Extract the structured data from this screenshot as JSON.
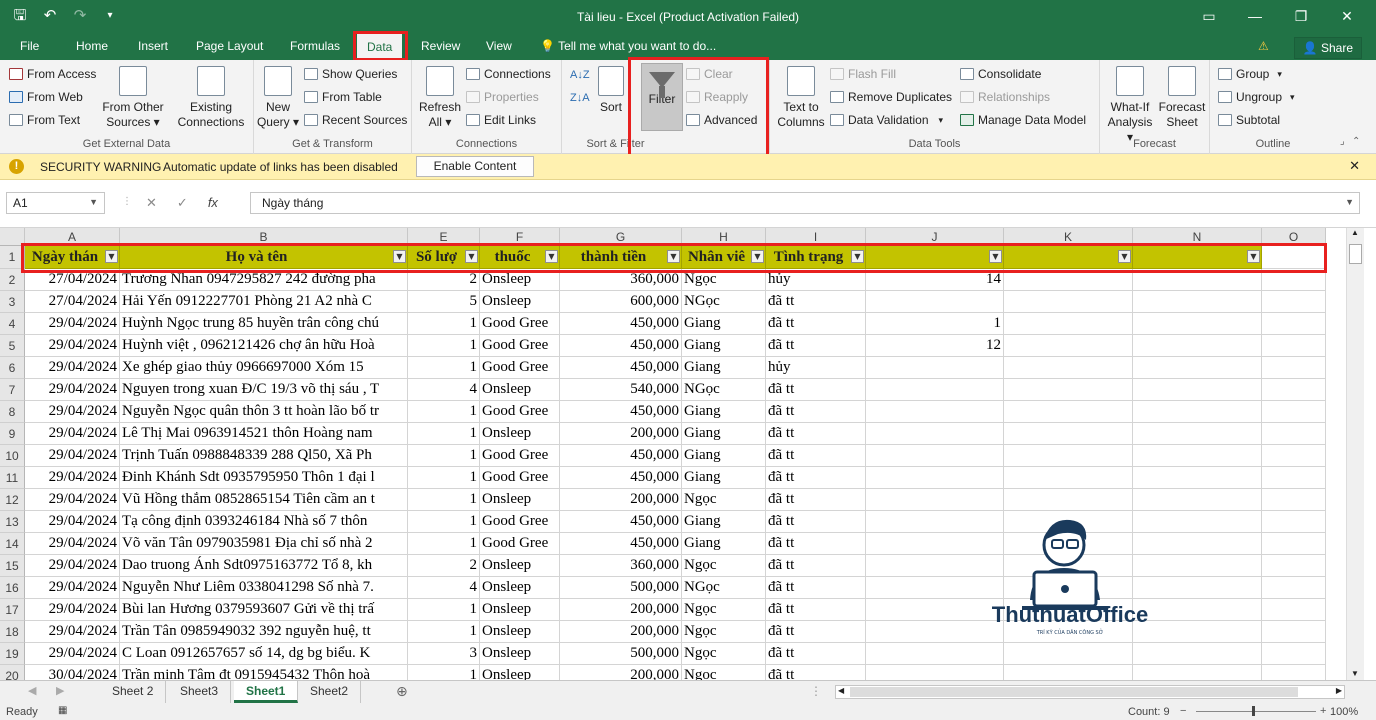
{
  "window": {
    "title": "Tài lieu - Excel (Product Activation Failed)"
  },
  "menu": {
    "file": "File",
    "home": "Home",
    "insert": "Insert",
    "page_layout": "Page Layout",
    "formulas": "Formulas",
    "data": "Data",
    "review": "Review",
    "view": "View",
    "tell_me": "Tell me what you want to do...",
    "share": "Share"
  },
  "ribbon": {
    "get_external": {
      "from_access": "From Access",
      "from_web": "From Web",
      "from_text": "From Text",
      "from_other_1": "From Other",
      "from_other_2": "Sources",
      "existing_1": "Existing",
      "existing_2": "Connections",
      "label": "Get External Data"
    },
    "get_transform": {
      "new_query_1": "New",
      "new_query_2": "Query",
      "show_queries": "Show Queries",
      "from_table": "From Table",
      "recent_sources": "Recent Sources",
      "label": "Get & Transform"
    },
    "connections": {
      "refresh_1": "Refresh",
      "refresh_2": "All",
      "connections": "Connections",
      "properties": "Properties",
      "edit_links": "Edit Links",
      "label": "Connections"
    },
    "sort_filter": {
      "sort": "Sort",
      "filter": "Filter",
      "clear": "Clear",
      "reapply": "Reapply",
      "advanced": "Advanced",
      "label": "Sort & Filter"
    },
    "data_tools": {
      "text_to_cols_1": "Text to",
      "text_to_cols_2": "Columns",
      "flash_fill": "Flash Fill",
      "remove_duplicates": "Remove Duplicates",
      "data_validation": "Data Validation",
      "consolidate": "Consolidate",
      "relationships": "Relationships",
      "manage_model": "Manage Data Model",
      "label": "Data Tools"
    },
    "forecast": {
      "whatif_1": "What-If",
      "whatif_2": "Analysis",
      "forecast_1": "Forecast",
      "forecast_2": "Sheet",
      "label": "Forecast"
    },
    "outline": {
      "group": "Group",
      "ungroup": "Ungroup",
      "subtotal": "Subtotal",
      "label": "Outline"
    }
  },
  "security": {
    "title": "SECURITY WARNING",
    "message": "Automatic update of links has been disabled",
    "button": "Enable Content"
  },
  "formula_bar": {
    "name_box": "A1",
    "fx": "fx",
    "value": "Ngày tháng"
  },
  "columns": [
    "A",
    "B",
    "E",
    "F",
    "G",
    "H",
    "I",
    "J",
    "K",
    "N",
    "O"
  ],
  "headers": [
    "Ngày thán",
    "Họ và tên",
    "Số lượ",
    "thuốc",
    "thành tiền",
    "Nhân viê",
    "Tình trạng",
    "",
    "",
    ""
  ],
  "rows": [
    {
      "n": "2",
      "a": "27/04/2024",
      "b": "Trương Nhan 0947295827 242 đường pha",
      "e": "2",
      "f": "Onsleep",
      "g": "360,000",
      "h": "Ngọc",
      "i": "hủy",
      "j": "14"
    },
    {
      "n": "3",
      "a": "27/04/2024",
      "b": "Hải Yến 0912227701 Phòng 21 A2 nhà C",
      "e": "5",
      "f": "Onsleep",
      "g": "600,000",
      "h": "NGọc",
      "i": "đã tt",
      "j": ""
    },
    {
      "n": "4",
      "a": "29/04/2024",
      "b": "Huỳnh Ngọc trung 85 huyền trân công chú",
      "e": "1",
      "f": "Good Gree",
      "g": "450,000",
      "h": "Giang",
      "i": "đã tt",
      "j": "1"
    },
    {
      "n": "5",
      "a": "29/04/2024",
      "b": "Huỳnh việt , 0962121426 chợ ân hữu Hoà",
      "e": "1",
      "f": "Good Gree",
      "g": "450,000",
      "h": "Giang",
      "i": "đã tt",
      "j": "12"
    },
    {
      "n": "6",
      "a": "29/04/2024",
      "b": " Xe ghép giao thủy 0966697000 Xóm 15",
      "e": "1",
      "f": "Good Gree",
      "g": "450,000",
      "h": "Giang",
      "i": "hủy",
      "j": ""
    },
    {
      "n": "7",
      "a": "29/04/2024",
      "b": "Nguyen trong xuan Đ/C 19/3 võ thị sáu , T",
      "e": "4",
      "f": "Onsleep",
      "g": "540,000",
      "h": "NGọc",
      "i": "đã tt",
      "j": ""
    },
    {
      "n": "8",
      "a": "29/04/2024",
      "b": "Nguyễn Ngọc quân thôn 3 tt hoàn lão bố tr",
      "e": "1",
      "f": "Good Gree",
      "g": "450,000",
      "h": "Giang",
      "i": "đã tt",
      "j": ""
    },
    {
      "n": "9",
      "a": "29/04/2024",
      "b": "Lê Thị Mai 0963914521 thôn Hoàng nam",
      "e": "1",
      "f": "Onsleep",
      "g": "200,000",
      "h": "Giang",
      "i": "đã tt",
      "j": ""
    },
    {
      "n": "10",
      "a": "29/04/2024",
      "b": "Trịnh Tuấn 0988848339 288 Ql50, Xã Ph",
      "e": "1",
      "f": "Good Gree",
      "g": "450,000",
      "h": "Giang",
      "i": "đã tt",
      "j": ""
    },
    {
      "n": "11",
      "a": "29/04/2024",
      "b": "Đinh Khánh Sdt 0935795950 Thôn 1 đại l",
      "e": "1",
      "f": "Good Gree",
      "g": "450,000",
      "h": "Giang",
      "i": "đã tt",
      "j": ""
    },
    {
      "n": "12",
      "a": "29/04/2024",
      "b": "Vũ Hồng thắm 0852865154 Tiên cầm an t",
      "e": "1",
      "f": "Onsleep",
      "g": "200,000",
      "h": "Ngọc",
      "i": "đã tt",
      "j": ""
    },
    {
      "n": "13",
      "a": "29/04/2024",
      "b": "Tạ công định 0393246184 Nhà số 7 thôn",
      "e": "1",
      "f": "Good Gree",
      "g": "450,000",
      "h": "Giang",
      "i": "đã tt",
      "j": ""
    },
    {
      "n": "14",
      "a": "29/04/2024",
      "b": " Võ văn Tân 0979035981 Địa chỉ số nhà 2",
      "e": "1",
      "f": "Good Gree",
      "g": "450,000",
      "h": "Giang",
      "i": "đã tt",
      "j": ""
    },
    {
      "n": "15",
      "a": "29/04/2024",
      "b": "Dao truong Ánh  Sdt0975163772 Tổ 8, kh",
      "e": "2",
      "f": "Onsleep",
      "g": "360,000",
      "h": "Ngọc",
      "i": "đã tt",
      "j": ""
    },
    {
      "n": "16",
      "a": "29/04/2024",
      "b": "Nguyễn Như Liêm 0338041298 Số nhà 7.",
      "e": "4",
      "f": "Onsleep",
      "g": "500,000",
      "h": "NGọc",
      "i": "đã tt",
      "j": ""
    },
    {
      "n": "17",
      "a": "29/04/2024",
      "b": "Bùi lan Hương 0379593607 Gửi về thị trấ",
      "e": "1",
      "f": "Onsleep",
      "g": "200,000",
      "h": "Ngọc",
      "i": "đã tt",
      "j": ""
    },
    {
      "n": "18",
      "a": "29/04/2024",
      "b": "Trần Tân 0985949032 392  nguyễn huệ, tt",
      "e": "1",
      "f": "Onsleep",
      "g": "200,000",
      "h": "Ngọc",
      "i": "đã tt",
      "j": ""
    },
    {
      "n": "19",
      "a": "29/04/2024",
      "b": "C Loan 0912657657 số 14, dg bg biểu. K",
      "e": "3",
      "f": "Onsleep",
      "g": "500,000",
      "h": "Ngọc",
      "i": "đã tt",
      "j": ""
    },
    {
      "n": "20",
      "a": "30/04/2024",
      "b": " Trần minh Tâm đt 0915945432 Thôn hoà",
      "e": "1",
      "f": "Onsleep",
      "g": "200,000",
      "h": "Ngọc",
      "i": "đã tt",
      "j": ""
    }
  ],
  "sheets": [
    "Sheet 2",
    "Sheet3",
    "Sheet1",
    "Sheet2"
  ],
  "active_sheet": "Sheet1",
  "status": {
    "ready": "Ready",
    "count": "Count: 9",
    "zoom": "100%"
  },
  "watermark": {
    "brand": "ThuthuatOffice",
    "tagline": "TRÍ KỲ CỦA DÂN CÔNG SỞ"
  },
  "colors": {
    "excel_green": "#217346",
    "header_fill": "#c3c300",
    "highlight": "#e8201f"
  }
}
